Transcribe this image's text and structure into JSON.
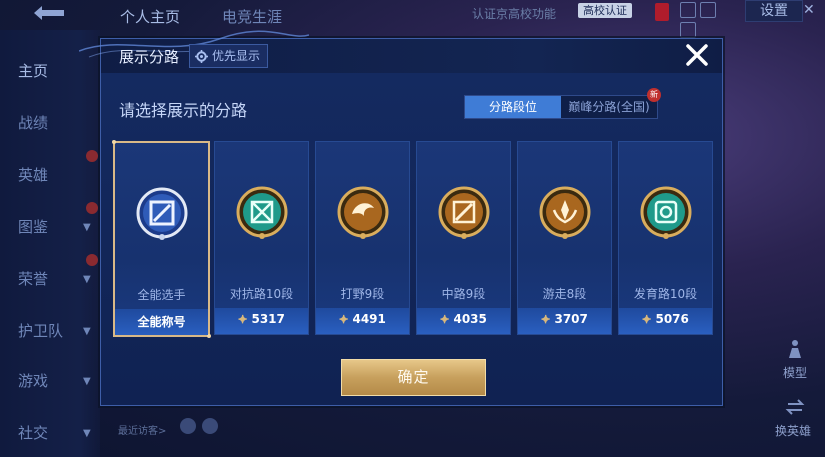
{
  "background": {
    "top_tabs": [
      "个人主页",
      "电竞生涯"
    ],
    "top_note": "认证京高校功能",
    "school_badge": "高校认证",
    "settings_label": "设置",
    "nav_items": [
      "主页",
      "战绩",
      "英雄",
      "图鉴",
      "荣誉",
      "护卫队",
      "游戏",
      "社交"
    ],
    "recent_visitors": "最近访客>",
    "right_labels": [
      "模型",
      "换英雄"
    ]
  },
  "modal": {
    "title": "展示分路",
    "priority_label": "优先显示",
    "close_icon": "close-icon",
    "prompt": "请选择展示的分路",
    "segment": {
      "options": [
        "分路段位",
        "巅峰分路(全国)"
      ],
      "selected": "分路段位",
      "new_tag": "新"
    },
    "cards": [
      {
        "role": "全能选手",
        "score": "全能称号",
        "icon": "all-round-emblem",
        "selected": true
      },
      {
        "role": "对抗路10段",
        "score": "5317",
        "icon": "clash-lane-emblem",
        "selected": false
      },
      {
        "role": "打野9段",
        "score": "4491",
        "icon": "jungle-emblem",
        "selected": false
      },
      {
        "role": "中路9段",
        "score": "4035",
        "icon": "mid-lane-emblem",
        "selected": false
      },
      {
        "role": "游走8段",
        "score": "3707",
        "icon": "roam-emblem",
        "selected": false
      },
      {
        "role": "发育路10段",
        "score": "5076",
        "icon": "farm-lane-emblem",
        "selected": false
      }
    ],
    "confirm_label": "确定"
  },
  "colors": {
    "modal_bg": "#16295f",
    "selected_border": "#d9b987",
    "segment_active": "#3f7cd6",
    "confirm_gold": "#c7a05d"
  }
}
